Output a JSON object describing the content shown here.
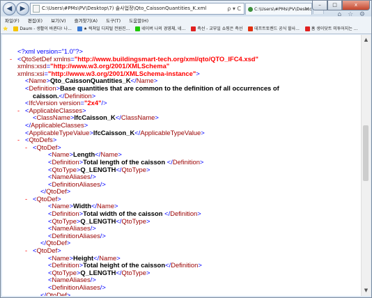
{
  "window": {
    "address": "C:\\Users\\#PMs\\PV\\Desktop\\7) 솔사업정\\Qto_CaissonQuantities_K.xml",
    "tab_label": "C:\\Users\\#PMs\\PV\\Deskto...",
    "back_icon": "back-arrow",
    "forward_icon": "forward-arrow",
    "search_symbol": "ρ",
    "refresh_symbol": "C",
    "close_tab_symbol": "×",
    "min_symbol": "–",
    "max_symbol": "□",
    "close_symbol": "x",
    "right_icons": "⌂ ☆ ⚙"
  },
  "menu": [
    "파일(F)",
    "편집(E)",
    "보기(V)",
    "즐겨찾기(A)",
    "도구(T)",
    "도움말(H)"
  ],
  "favorites": [
    {
      "label": "Daum - 생활이 바뀐다! 나...",
      "color": "#f5c400"
    },
    {
      "label": "★ 럭쳐일 디지털 전원진...",
      "color": "#3a7bd5"
    },
    {
      "label": "네이버 나의 경영체, 네...",
      "color": "#1ec800"
    },
    {
      "label": "측선 - 교부일 쇼핑은 측선",
      "color": "#e02020"
    },
    {
      "label": "데프트토렌드 공식 할사...",
      "color": "#e03010"
    },
    {
      "label": "홈 생이닷트 미투어지는 ...",
      "color": "#e02020"
    }
  ],
  "xml": {
    "decl": "<?xml version=\"1.0\"?>",
    "root_tag": "QtoSetDef",
    "root_xmlns_attr": "xmlns",
    "root_xmlns_val": "\"http://www.buildingsmart-tech.org/xml/qto/QTO_IFC4.xsd\"",
    "xsd_attr": "xmlns:xsd",
    "xsd_val": "\"http://www.w3.org/2001/XMLSchema\"",
    "xsi_attr": "xmlns:xsi",
    "xsi_val": "\"http://www.w3.org/2001/XMLSchema-instance\"",
    "set_name": "Qto_CaissonQuantities_K",
    "set_definition_1": "Base quantities that are common to the definition of all occurrences of",
    "set_definition_2": "caisson.",
    "ifc_version_attr": "version",
    "ifc_version_val": "\"2x4\"",
    "class_name": "IfcCaisson_K",
    "applicable_type_value": "IfcCaisson_K",
    "qto_defs": [
      {
        "name": "Length",
        "definition": "Total length of the caisson ",
        "qto_type": "Q_LENGTH"
      },
      {
        "name": "Width",
        "definition": "Total width of the caisson ",
        "qto_type": "Q_LENGTH"
      },
      {
        "name": "Height",
        "definition": "Total height of the caisson",
        "qto_type": "Q_LENGTH"
      }
    ],
    "tags": {
      "name": "Name",
      "definition": "Definition",
      "ifc_version": "IfcVersion",
      "applicable_classes": "ApplicableClasses",
      "class_name": "ClassName",
      "applicable_type_value": "ApplicableTypeValue",
      "qto_defs": "QtoDefs",
      "qto_def": "QtoDef",
      "qto_type": "QtoType",
      "name_aliases": "NameAliases",
      "definition_aliases": "DefinitionAliases"
    }
  }
}
